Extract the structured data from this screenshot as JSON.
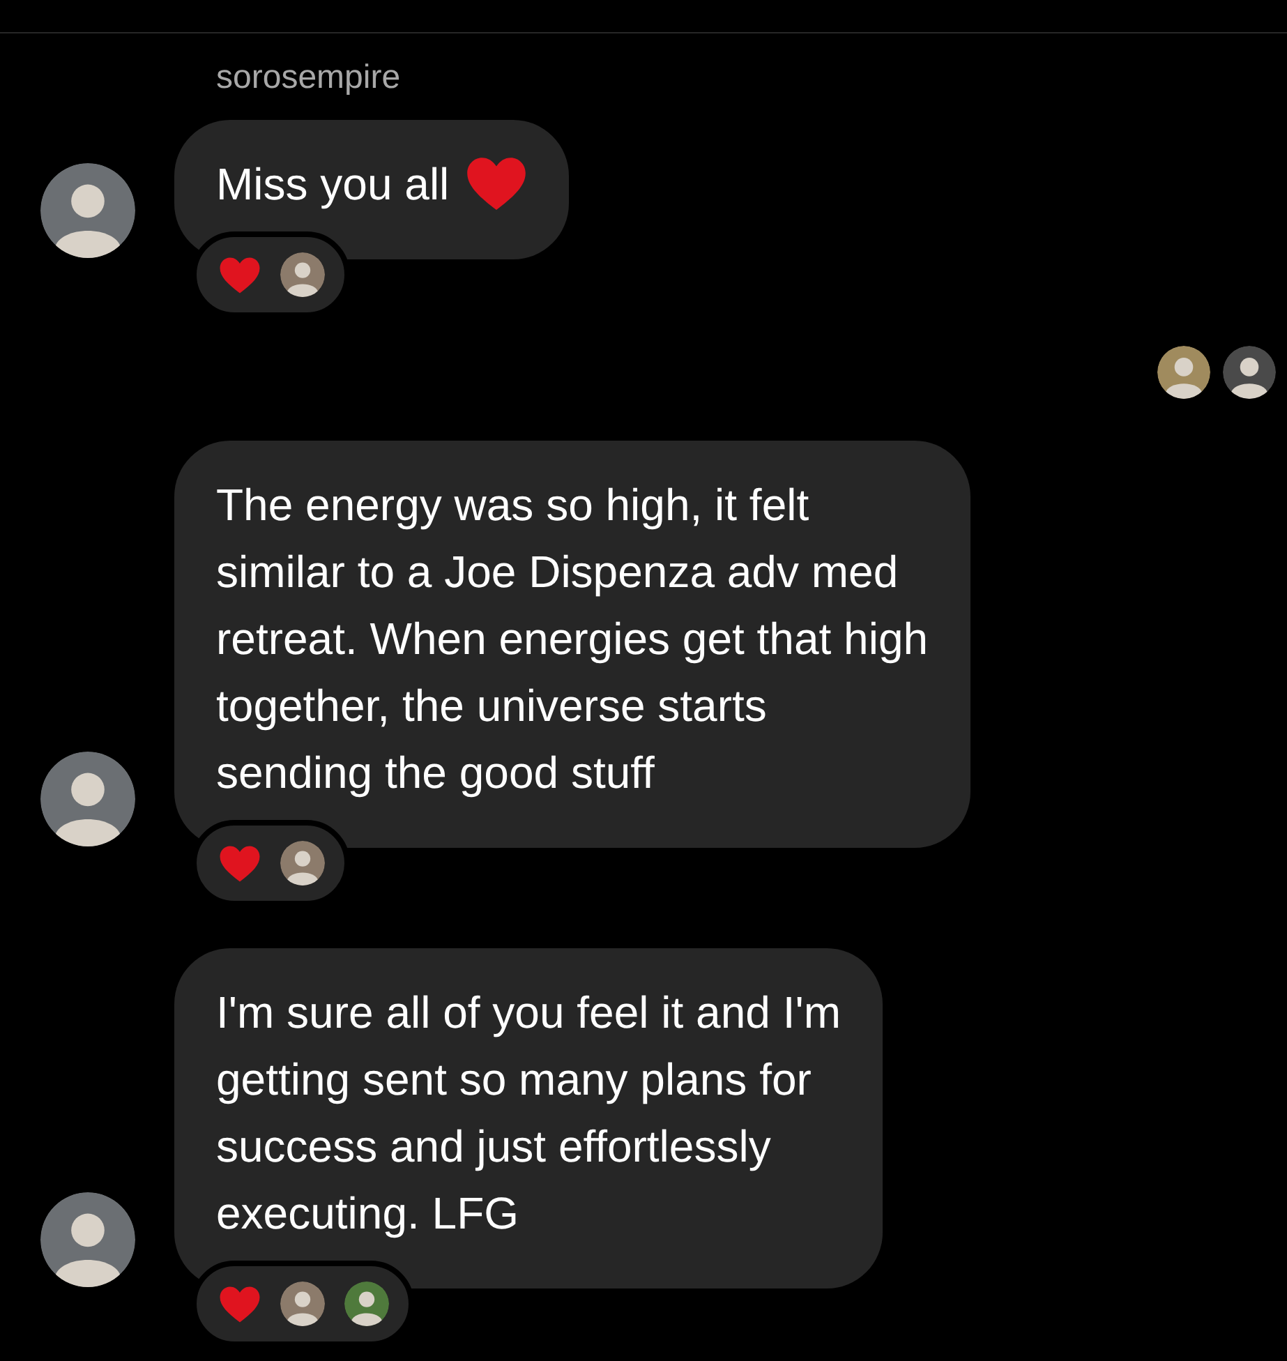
{
  "sender": {
    "name": "sorosempire"
  },
  "messages": [
    {
      "lines": [
        "Miss you all"
      ],
      "trailing": {
        "kind": "heart"
      },
      "reactions": [
        {
          "kind": "heart",
          "users": [
            {
              "color": "#8c7b6b"
            }
          ]
        }
      ]
    },
    {
      "lines": [
        "The energy was so high, it felt",
        "similar to a Joe Dispenza adv med",
        "retreat. When energies get that high",
        "together, the universe starts",
        "sending the good stuff"
      ],
      "reactions": [
        {
          "kind": "heart",
          "users": [
            {
              "color": "#8c7b6b"
            }
          ]
        }
      ],
      "seen_by_above": [
        {
          "color": "#a08b5e"
        },
        {
          "color": "#4a4a4a"
        }
      ]
    },
    {
      "lines": [
        "I'm sure all of you feel it and I'm",
        "getting sent so many plans for",
        "success and just effortlessly",
        "executing. LFG"
      ],
      "reactions": [
        {
          "kind": "heart",
          "users": [
            {
              "color": "#8c7b6b"
            },
            {
              "color": "#4f7a3c"
            }
          ]
        }
      ]
    }
  ]
}
